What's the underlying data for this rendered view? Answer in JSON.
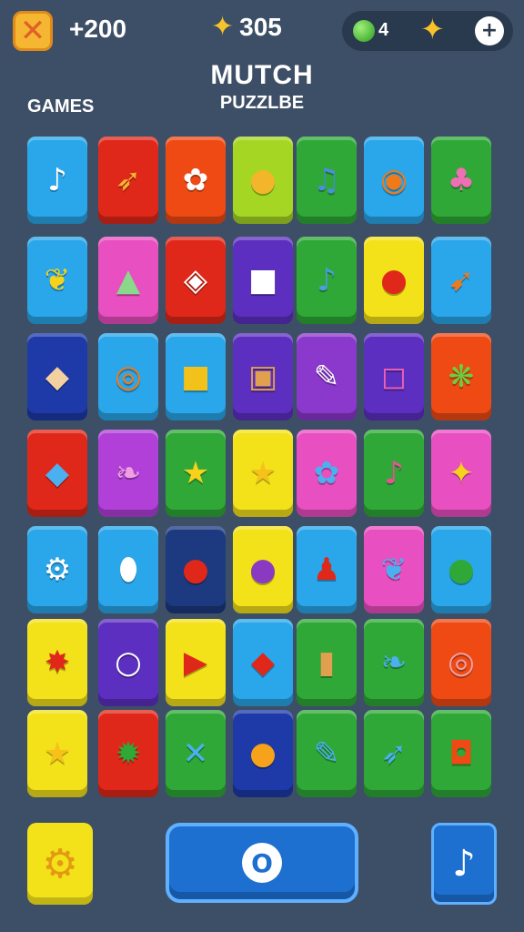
{
  "header": {
    "score": "+200",
    "coins": "305",
    "gem_count": "4"
  },
  "title": {
    "main": "MUTCH",
    "sub": "PUZZLBE",
    "games_label": "GAMES"
  },
  "board": {
    "rows": [
      [
        {
          "bg": "#2aa6ea",
          "icon": "♪",
          "color": "#ffffff",
          "name": "music-note-icon"
        },
        {
          "bg": "#e0281a",
          "icon": "➶",
          "color": "#f5b731",
          "name": "carrot-icon"
        },
        {
          "bg": "#ef4a14",
          "icon": "✿",
          "color": "#ffffff",
          "name": "flower-icon"
        },
        {
          "bg": "#a6d624",
          "icon": "●",
          "color": "#f3b52a",
          "name": "lollipop-icon"
        },
        {
          "bg": "#2fa838",
          "icon": "♫",
          "color": "#4a8ee0",
          "name": "music-notes-icon"
        },
        {
          "bg": "#2aa6ea",
          "icon": "◉",
          "color": "#f07a1a",
          "name": "donut-icon"
        },
        {
          "bg": "#2fa838",
          "icon": "♣",
          "color": "#ef6fb5",
          "name": "tree-icon"
        }
      ],
      [
        {
          "bg": "#2aa6ea",
          "icon": "❦",
          "color": "#f6d21a",
          "name": "banana-icon"
        },
        {
          "bg": "#e84fc0",
          "icon": "▲",
          "color": "#8ad88a",
          "name": "triangle-icon"
        },
        {
          "bg": "#e0281a",
          "icon": "◈",
          "color": "#ffffff",
          "name": "shape-icon"
        },
        {
          "bg": "#5c2fc0",
          "icon": "■",
          "color": "#ffffff",
          "name": "box-icon"
        },
        {
          "bg": "#2fa838",
          "icon": "♪",
          "color": "#4a9ee0",
          "name": "music-note-icon"
        },
        {
          "bg": "#f3e21a",
          "icon": "●",
          "color": "#e0281a",
          "name": "apple-icon"
        },
        {
          "bg": "#2aa6ea",
          "icon": "➹",
          "color": "#f07a1a",
          "name": "carrot-icon"
        }
      ],
      [
        {
          "bg": "#1d3aa8",
          "icon": "◆",
          "color": "#f2d0a0",
          "name": "eraser-icon"
        },
        {
          "bg": "#2aa6ea",
          "icon": "◎",
          "color": "#f07a1a",
          "name": "camera-icon"
        },
        {
          "bg": "#2aa6ea",
          "icon": "■",
          "color": "#f3c21a",
          "name": "bag-icon"
        },
        {
          "bg": "#5c2fc0",
          "icon": "▣",
          "color": "#e0a050",
          "name": "radio-icon"
        },
        {
          "bg": "#8b38cc",
          "icon": "✎",
          "color": "#ffffff",
          "name": "note-icon"
        },
        {
          "bg": "#5c2fc0",
          "icon": "◻",
          "color": "#ef5fb5",
          "name": "bag-icon"
        },
        {
          "bg": "#ef4a14",
          "icon": "❋",
          "color": "#6ad040",
          "name": "leaf-icon"
        }
      ],
      [
        {
          "bg": "#e0281a",
          "icon": "◆",
          "color": "#4ab0f0",
          "name": "cube-icon"
        },
        {
          "bg": "#b040d8",
          "icon": "❧",
          "color": "#f0a0e0",
          "name": "feather-icon"
        },
        {
          "bg": "#2fa838",
          "icon": "★",
          "color": "#f6d21a",
          "name": "star-icon"
        },
        {
          "bg": "#f3e21a",
          "icon": "★",
          "color": "#f6c21a",
          "name": "star-icon"
        },
        {
          "bg": "#e84fc0",
          "icon": "✿",
          "color": "#4ab0f0",
          "name": "flower-icon"
        },
        {
          "bg": "#2fa838",
          "icon": "♪",
          "color": "#ef4f9a",
          "name": "music-note-icon"
        },
        {
          "bg": "#e84fc0",
          "icon": "✦",
          "color": "#f6d21a",
          "name": "bird-icon"
        }
      ],
      [
        {
          "bg": "#2aa6ea",
          "icon": "⚙",
          "color": "#ffffff",
          "name": "gear-icon"
        },
        {
          "bg": "#2aa6ea",
          "icon": "⬮",
          "color": "#ffffff",
          "name": "egg-icon"
        },
        {
          "bg": "#1d3a80",
          "icon": "●",
          "color": "#e0281a",
          "name": "strawberry-icon"
        },
        {
          "bg": "#f3e21a",
          "icon": "●",
          "color": "#8a3ac0",
          "name": "plum-icon"
        },
        {
          "bg": "#2aa6ea",
          "icon": "♟",
          "color": "#e0281a",
          "name": "bowling-pin-icon"
        },
        {
          "bg": "#e84fc0",
          "icon": "❦",
          "color": "#4ab0f0",
          "name": "leaf-icon"
        },
        {
          "bg": "#2aa6ea",
          "icon": "●",
          "color": "#2fa838",
          "name": "chat-bubble-icon"
        }
      ],
      [
        {
          "bg": "#f3e21a",
          "icon": "✸",
          "color": "#e0281a",
          "name": "burst-icon"
        },
        {
          "bg": "#5c2fc0",
          "icon": "○",
          "color": "#ffffff",
          "name": "ring-icon"
        },
        {
          "bg": "#f3e21a",
          "icon": "▶",
          "color": "#e0281a",
          "name": "play-triangle-icon"
        },
        {
          "bg": "#2aa6ea",
          "icon": "◆",
          "color": "#e0281a",
          "name": "ribbon-icon"
        },
        {
          "bg": "#2fa838",
          "icon": "▮",
          "color": "#e0a050",
          "name": "mug-icon"
        },
        {
          "bg": "#2fa838",
          "icon": "❧",
          "color": "#4ab0f0",
          "name": "leaf-icon"
        },
        {
          "bg": "#ef4a14",
          "icon": "◎",
          "color": "#f0a0a0",
          "name": "spiral-icon"
        }
      ],
      [
        {
          "bg": "#f3e21a",
          "icon": "★",
          "color": "#f6c21a",
          "name": "star-icon"
        },
        {
          "bg": "#e0281a",
          "icon": "✹",
          "color": "#2fa838",
          "name": "gear-flower-icon"
        },
        {
          "bg": "#2fa838",
          "icon": "✕",
          "color": "#4ab0f0",
          "name": "propeller-icon"
        },
        {
          "bg": "#1d3aa8",
          "icon": "●",
          "color": "#f6a21a",
          "name": "bug-icon"
        },
        {
          "bg": "#2fa838",
          "icon": "✎",
          "color": "#4ab0f0",
          "name": "pencil-icon"
        },
        {
          "bg": "#2fa838",
          "icon": "➶",
          "color": "#4ab0f0",
          "name": "bird-icon"
        },
        {
          "bg": "#2fa838",
          "icon": "◘",
          "color": "#ef4a14",
          "name": "camera-icon"
        }
      ]
    ]
  },
  "bottom": {
    "left_icon": "⚙",
    "center_icon": "O",
    "right_icon": "♪"
  },
  "icons": {
    "close": "✕",
    "coin_star": "✦",
    "res_star": "✦",
    "grid": "+"
  }
}
